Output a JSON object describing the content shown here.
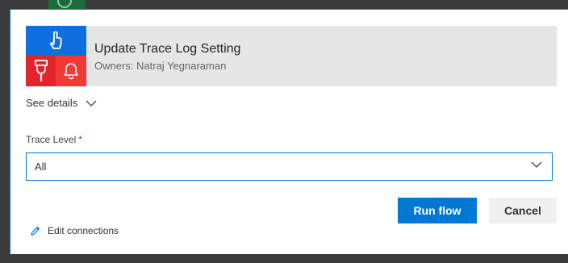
{
  "flow": {
    "title": "Update Trace Log Setting",
    "owners": "Owners: Natraj Yegnaraman"
  },
  "details": {
    "label": "See details"
  },
  "trace_level": {
    "label": "Trace Level",
    "required_marker": "*",
    "value": "All"
  },
  "actions": {
    "run_label": "Run flow",
    "cancel_label": "Cancel",
    "edit_connections_label": "Edit connections"
  },
  "colors": {
    "accent": "#0078d4",
    "tile_blue": "#0f6fde",
    "tile_red": "#e4242b",
    "tile_red_light": "#f13a36",
    "required": "#c4262e"
  },
  "icons": {
    "trigger": "touch-hand-icon",
    "connector_1": "plug-icon",
    "connector_2": "bell-icon",
    "expand": "chevron-down-icon",
    "dropdown": "chevron-down-icon",
    "edit": "pencil-icon"
  }
}
